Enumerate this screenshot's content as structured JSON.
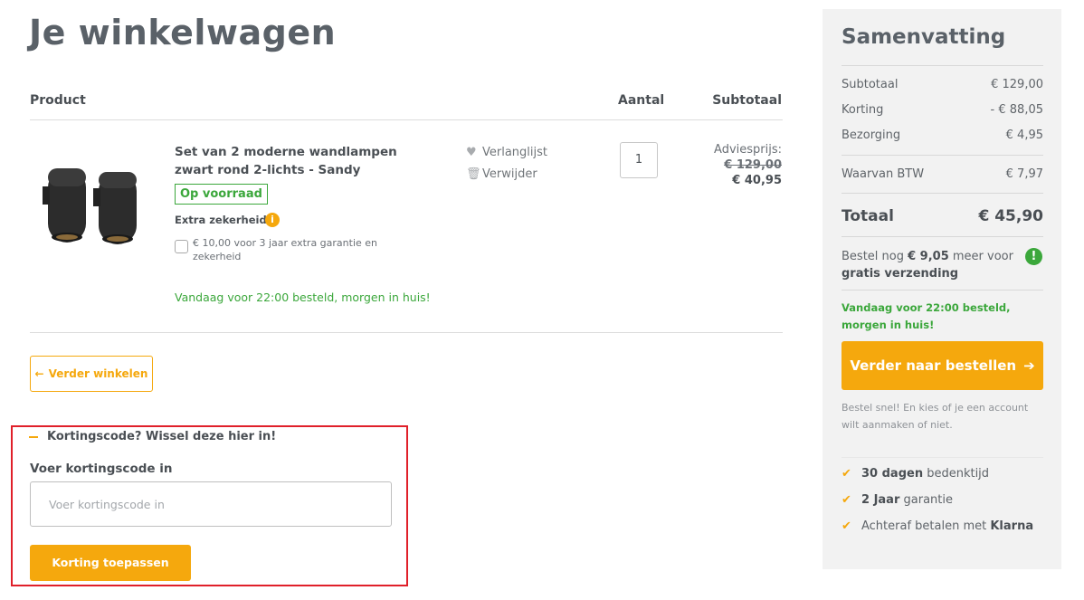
{
  "page": {
    "title": "Je winkelwagen"
  },
  "table": {
    "headers": {
      "product": "Product",
      "quantity": "Aantal",
      "subtotal": "Subtotaal"
    }
  },
  "item": {
    "title": "Set van 2 moderne wandlampen zwart rond 2-lichts - Sandy",
    "stock": "Op voorraad",
    "extra_label": "Extra zekerheid",
    "extra_option": "€ 10,00 voor 3 jaar extra garantie en zekerheid",
    "delivery": "Vandaag voor 22:00 besteld, morgen in huis!",
    "wishlist": "Verlanglijst",
    "remove": "Verwijder",
    "quantity": "1",
    "advice_label": "Adviesprijs:",
    "old_price": "€ 129,00",
    "price": "€ 40,95"
  },
  "continue_button": "Verder winkelen",
  "coupon": {
    "toggle": "Kortingscode? Wissel deze hier in!",
    "label": "Voer kortingscode in",
    "placeholder": "Voer kortingscode in",
    "apply": "Korting toepassen"
  },
  "summary": {
    "title": "Samenvatting",
    "rows": [
      {
        "label": "Subtotaal",
        "value": "€ 129,00"
      },
      {
        "label": "Korting",
        "value": "- € 88,05"
      },
      {
        "label": "Bezorging",
        "value": "€ 4,95"
      },
      {
        "label": "Waarvan BTW",
        "value": "€ 7,97"
      }
    ],
    "total_label": "Totaal",
    "total_value": "€ 45,90",
    "freeship_pre": "Bestel nog ",
    "freeship_amount": "€ 9,05",
    "freeship_mid": " meer voor ",
    "freeship_bold": "gratis verzending",
    "delivery": "Vandaag voor 22:00 besteld, morgen in huis!",
    "order_button": "Verder naar bestellen",
    "order_note": "Bestel snel! En kies of je een account wilt aanmaken of niet.",
    "usps": [
      {
        "bold": "30 dagen",
        "text": " bedenktijd"
      },
      {
        "bold": "2 Jaar",
        "text": " garantie"
      },
      {
        "text": "Achteraf betalen met ",
        "bold": "Klarna"
      }
    ]
  },
  "colors": {
    "accent": "#f5a80d",
    "success": "#3ba73b",
    "highlight": "#e0202a"
  }
}
